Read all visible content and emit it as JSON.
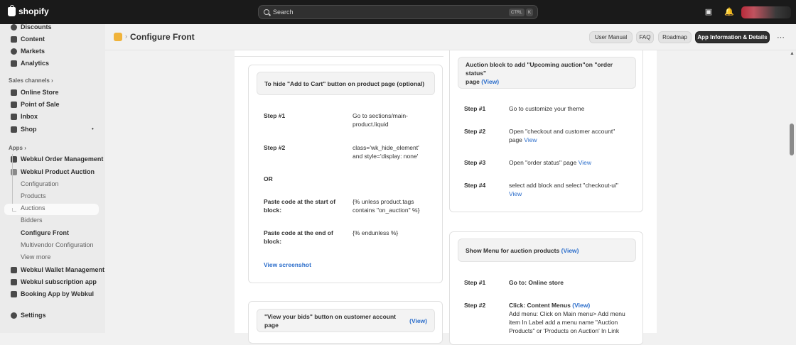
{
  "topbar": {
    "brand": "shopify",
    "search_placeholder": "Search",
    "shortcut_ctrl": "CTRL",
    "shortcut_key": "K"
  },
  "sidebar": {
    "items_top": [
      {
        "label": "Discounts",
        "icon": "discount-icon"
      },
      {
        "label": "Content",
        "icon": "content-icon"
      },
      {
        "label": "Markets",
        "icon": "globe-icon"
      },
      {
        "label": "Analytics",
        "icon": "analytics-icon"
      }
    ],
    "sales_channels_heading": "Sales channels",
    "sales_channels": [
      {
        "label": "Online Store",
        "icon": "store-icon"
      },
      {
        "label": "Point of Sale",
        "icon": "pos-icon"
      },
      {
        "label": "Inbox",
        "icon": "inbox-icon"
      },
      {
        "label": "Shop",
        "icon": "shop-icon"
      }
    ],
    "apps_heading": "Apps",
    "apps": [
      {
        "label": "Webkul Order Management"
      },
      {
        "label": "Webkul Product Auction"
      }
    ],
    "sub_items": [
      "Configuration",
      "Products",
      "Auctions",
      "Bidders",
      "Configure Front",
      "Multivendor Configuration",
      "View more"
    ],
    "apps_more": [
      {
        "label": "Webkul Wallet Management"
      },
      {
        "label": "Webkul subscription app"
      },
      {
        "label": "Booking App by Webkul"
      }
    ],
    "settings": "Settings"
  },
  "header": {
    "title": "Configure Front",
    "buttons": [
      "User Manual",
      "FAQ",
      "Roadmap",
      "App Information & Details"
    ]
  },
  "left_card1": {
    "title": "To hide \"Add to Cart\" button on product page (optional)",
    "rows": [
      {
        "label": "Step #1",
        "value_line1": "Go to sections/main-",
        "value_line2": "product.liquid"
      },
      {
        "label": "Step #2",
        "value_line1": "class='wk_hide_element'",
        "value_line2": "and style='display: none'"
      },
      {
        "label": "OR"
      },
      {
        "label_line1": "Paste code at the start of",
        "label_line2": "block:",
        "value_line1": "{% unless product.tags",
        "value_line2": "contains \"on_auction\" %}"
      },
      {
        "label_line1": "Paste code at the end of",
        "label_line2": "block:",
        "value_line1": "{% endunless %}"
      }
    ],
    "link": "View screenshot"
  },
  "left_card2": {
    "title": "\"View your bids\" button on customer account page",
    "link": "(View)"
  },
  "right_card1": {
    "title_line1": "Auction block to add \"Upcoming auction\"on \"order status\"",
    "title_line2": "page",
    "title_link": "(View)",
    "rows": [
      {
        "label": "Step #1",
        "value": "Go to customize your theme"
      },
      {
        "label": "Step #2",
        "value_line1": "Open \"checkout and customer account\"",
        "value_line2": "page",
        "link": "View"
      },
      {
        "label": "Step #3",
        "value": "Open \"order status\" page",
        "link": "View"
      },
      {
        "label": "Step #4",
        "value_line1": "select add block and select \"checkout-ui\"",
        "link": "View"
      }
    ]
  },
  "right_card2": {
    "title": "Show Menu for auction products",
    "title_link": "(View)",
    "rows": [
      {
        "label": "Step #1",
        "value": "Go to: Online store"
      },
      {
        "label": "Step #2",
        "value_bold": "Click: Content Menus",
        "link": "(View)",
        "value_line2": "Add menu: Click on Main menu> Add menu",
        "value_line3": "item In Label add a menu name \"Auction",
        "value_line4": "Products\" or 'Products on Auction' In Link"
      }
    ]
  },
  "colors": {
    "link": "#2c6ecb",
    "topbar": "#1a1a1a",
    "accent_app_icon": "#f0b33a"
  }
}
